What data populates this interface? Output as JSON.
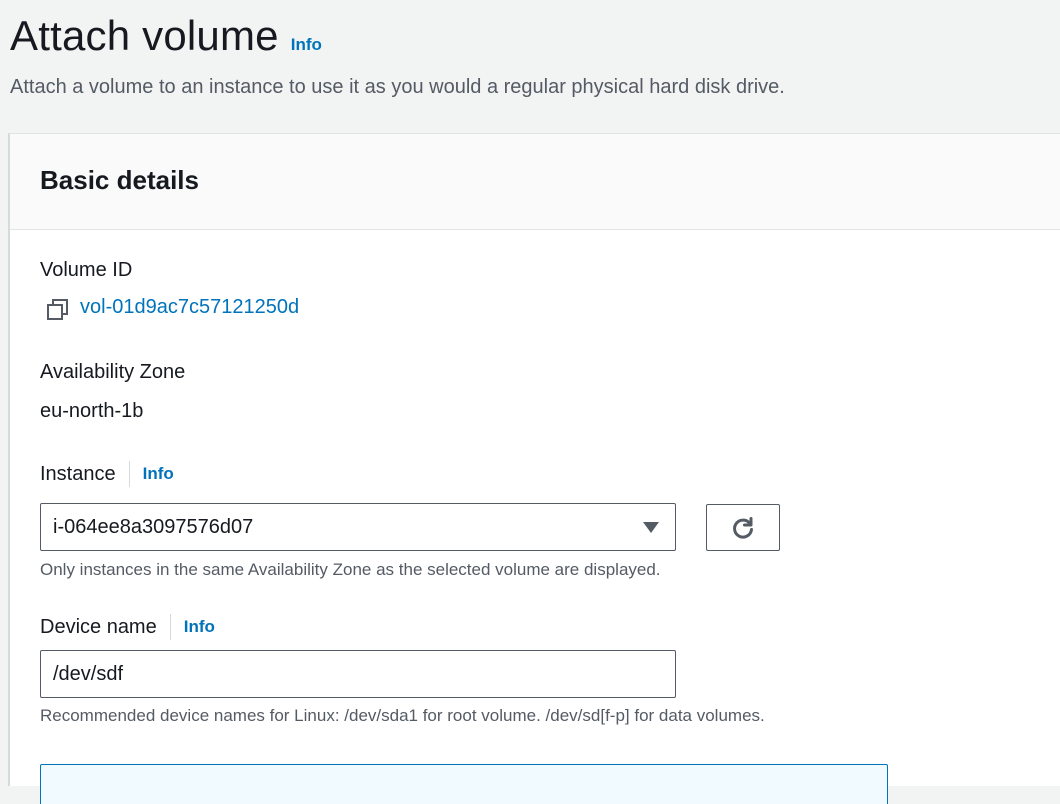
{
  "header": {
    "title": "Attach volume",
    "info_label": "Info",
    "description": "Attach a volume to an instance to use it as you would a regular physical hard disk drive."
  },
  "panel": {
    "title": "Basic details",
    "volume": {
      "label": "Volume ID",
      "id": "vol-01d9ac7c57121250d",
      "copy_icon": "copy-icon"
    },
    "availability_zone": {
      "label": "Availability Zone",
      "value": "eu-north-1b"
    },
    "instance": {
      "label": "Instance",
      "info_label": "Info",
      "selected": "i-064ee8a3097576d07",
      "hint": "Only instances in the same Availability Zone as the selected volume are displayed.",
      "refresh_icon": "refresh-icon"
    },
    "device": {
      "label": "Device name",
      "info_label": "Info",
      "value": "/dev/sdf",
      "hint": "Recommended device names for Linux: /dev/sda1 for root volume. /dev/sd[f-p] for data volumes."
    }
  },
  "colors": {
    "link": "#0073bb",
    "text": "#16191f",
    "muted": "#545b64",
    "background": "#f2f3f3"
  }
}
